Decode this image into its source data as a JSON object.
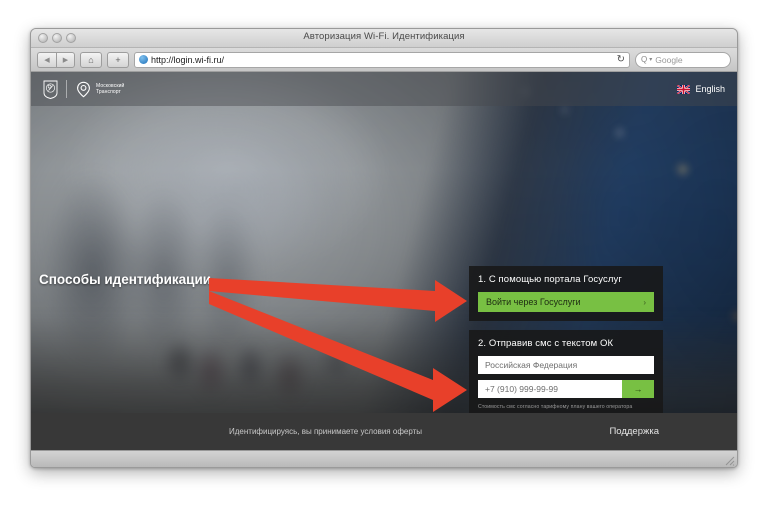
{
  "browser": {
    "window_title": "Авторизация Wi-Fi. Идентификация",
    "traffic_lights": [
      "close-button",
      "minimize-button",
      "zoom-button"
    ],
    "back_glyph": "◀",
    "forward_glyph": "▶",
    "home_glyph": "⌂",
    "add_tab_glyph": "+",
    "url": "http://login.wi-fi.ru/",
    "reload_glyph": "↻",
    "search_glyph": "Q",
    "search_caret_glyph": "▾",
    "search_placeholder": "Google"
  },
  "header": {
    "coat_of_arms_alt": "Герб Москвы",
    "transport_logo_text": "Московский\nТранспорт",
    "lang_label": "English",
    "flag_alt": "UK flag"
  },
  "annotation": {
    "label": "Способы идентификации",
    "arrow_color": "#e8402a",
    "arrow_count": 2
  },
  "auth": {
    "panel1": {
      "title": "1. С помощью портала Госуслуг",
      "button_label": "Войти через Госуслуги",
      "button_chevron": "›",
      "button_color": "#78c043"
    },
    "panel2": {
      "title": "2. Отправив смс с текстом ОК",
      "country_value": "Российская Федерация",
      "phone_placeholder": "+7 (910) 999-99-99",
      "submit_glyph": "→",
      "submit_color": "#78c043",
      "fineprint": "Стоимость смс согласно тарифному плану вашего оператора"
    }
  },
  "footer": {
    "offer_text": "Идентифицируясь, вы принимаете условия оферты",
    "support_label": "Поддержка"
  }
}
